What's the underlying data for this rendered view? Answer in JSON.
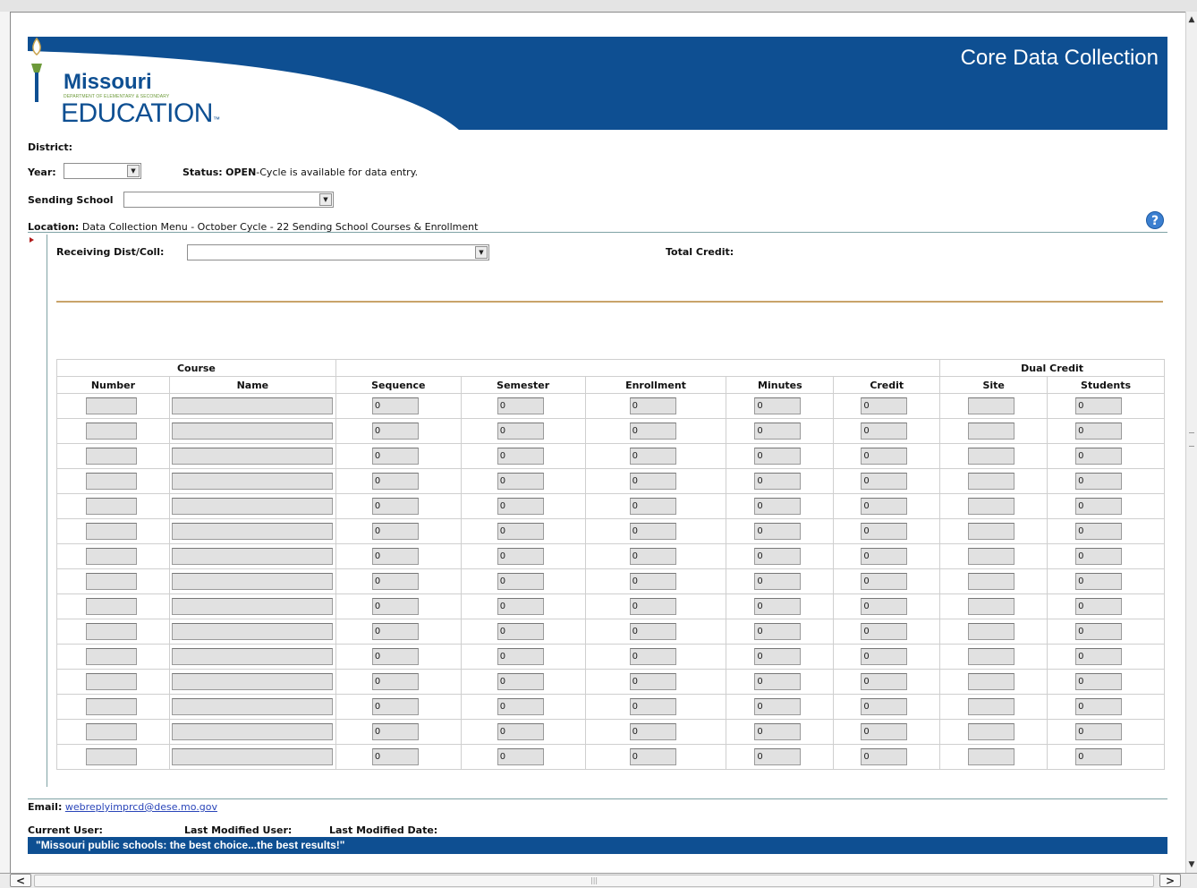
{
  "header": {
    "title": "Core Data Collection",
    "logo_state": "Missouri",
    "logo_dept": "DEPARTMENT OF ELEMENTARY & SECONDARY",
    "logo_education": "EDUCATION",
    "logo_trademark": "™"
  },
  "filters": {
    "district_label": "District:",
    "year_label": "Year:",
    "year_value": "",
    "status_label": "Status:",
    "status_value": "OPEN",
    "status_text": "-Cycle is available for data entry.",
    "sending_school_label": "Sending School",
    "sending_school_value": ""
  },
  "location": {
    "label": "Location:",
    "path": "Data Collection Menu - October Cycle - 22 Sending School Courses & Enrollment"
  },
  "form": {
    "receiving_label": "Receiving Dist/Coll:",
    "receiving_value": "",
    "total_credit_label": "Total Credit:"
  },
  "table": {
    "group_headers": {
      "course": "Course",
      "dual_credit": "Dual Credit"
    },
    "columns": [
      "Number",
      "Name",
      "Sequence",
      "Semester",
      "Enrollment",
      "Minutes",
      "Credit",
      "Site",
      "Students"
    ],
    "row_count": 15,
    "default_value": "0"
  },
  "footer": {
    "email_label": "Email:",
    "email": "webreplyimprcd@dese.mo.gov",
    "current_user_label": "Current User:",
    "last_modified_user_label": "Last Modified User:",
    "last_modified_date_label": "Last Modified Date:",
    "slogan": "\"Missouri public schools: the best choice...the best results!\""
  },
  "colors": {
    "brand_blue": "#0e4f92",
    "divider_teal": "#7fa2a5",
    "divider_gold": "#c9a46a",
    "input_gray": "#e1e1e1"
  },
  "icons": [
    "help-icon",
    "dropdown-arrow-icon",
    "scroll-left-icon",
    "scroll-right-icon",
    "scroll-up-icon",
    "scroll-down-icon"
  ]
}
